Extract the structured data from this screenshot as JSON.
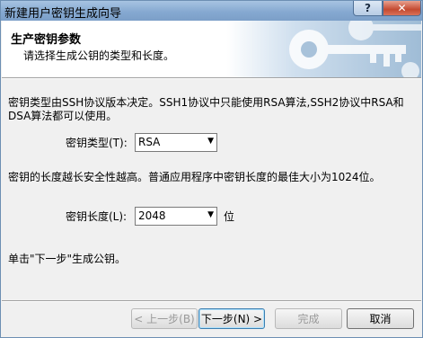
{
  "window": {
    "title": "新建用户密钥生成向导",
    "help_label": "?",
    "close_label": "✕"
  },
  "header": {
    "title": "生产密钥参数",
    "subtitle": "请选择生成公钥的类型和长度。"
  },
  "body": {
    "desc_line1": "密钥类型由SSH协议版本决定。SSH1协议中只能使用RSA算法,SSH2协议中RSA和",
    "desc_line2": "DSA算法都可以使用。",
    "key_type_label": "密钥类型(T):",
    "key_type_value": "RSA",
    "length_desc": "密钥的长度越长安全性越高。普通应用程序中密钥长度的最佳大小为1024位。",
    "key_length_label": "密钥长度(L):",
    "key_length_value": "2048",
    "key_length_unit": "位",
    "hint": "单击\"下一步\"生成公钥。"
  },
  "buttons": {
    "back": "< 上一步(B)",
    "next": "下一步(N) >",
    "finish": "完成",
    "cancel": "取消"
  }
}
